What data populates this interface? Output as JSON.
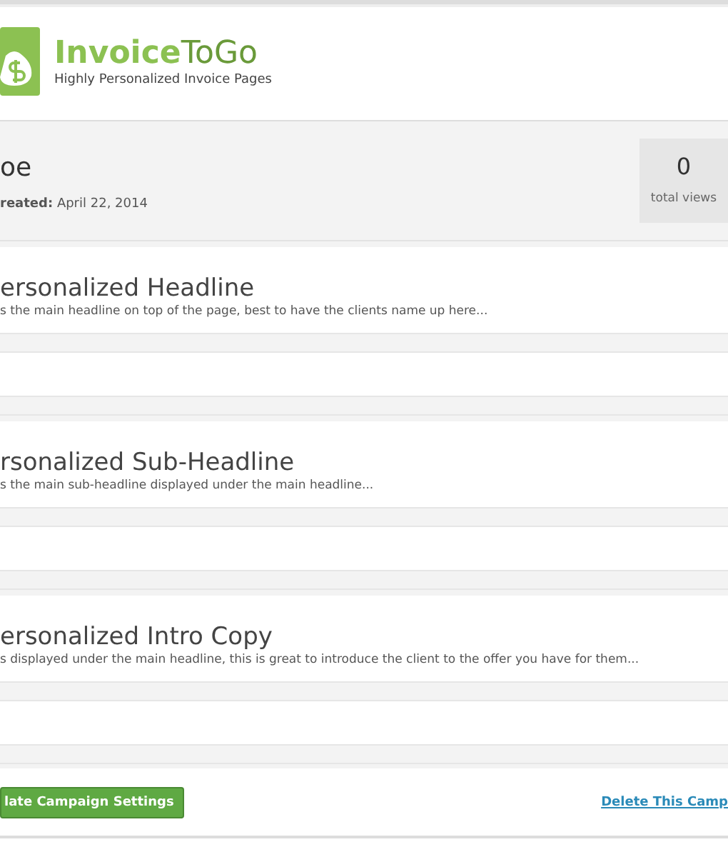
{
  "header": {
    "brand_bold": "Invoice",
    "brand_light": "ToGo",
    "tagline": "Highly Personalized Invoice Pages"
  },
  "campaign": {
    "name": "oe",
    "created_label": "reated:",
    "created_date": "April 22, 2014",
    "views_count": "0",
    "views_label": "total views"
  },
  "sections": [
    {
      "title": "ersonalized Headline",
      "description": "s the main headline on top of the page, best to have the clients name up here..."
    },
    {
      "title": "rsonalized Sub-Headline",
      "description": "s the main sub-headline displayed under the main headline..."
    },
    {
      "title": "ersonalized Intro Copy",
      "description": "s displayed under the main headline, this is great to introduce the client to the offer you have for them..."
    }
  ],
  "footer": {
    "update_button": "late Campaign Settings",
    "delete_link": "Delete This Camp"
  }
}
